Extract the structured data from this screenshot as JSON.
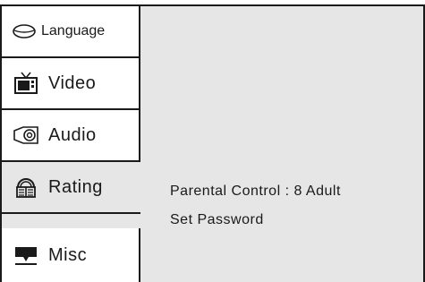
{
  "sidebar": {
    "items": [
      {
        "label": "Language",
        "icon": "language-icon"
      },
      {
        "label": "Video",
        "icon": "tv-icon"
      },
      {
        "label": "Audio",
        "icon": "speaker-icon"
      },
      {
        "label": "Rating",
        "icon": "rating-icon",
        "active": true
      },
      {
        "label": "Misc",
        "icon": "misc-icon"
      }
    ]
  },
  "content": {
    "parental_control": "Parental Control  : 8 Adult",
    "set_password": "Set  Password"
  },
  "colors": {
    "panel_background": "#e6e6e6",
    "tab_background": "#ffffff",
    "border": "#1a1a1a"
  }
}
